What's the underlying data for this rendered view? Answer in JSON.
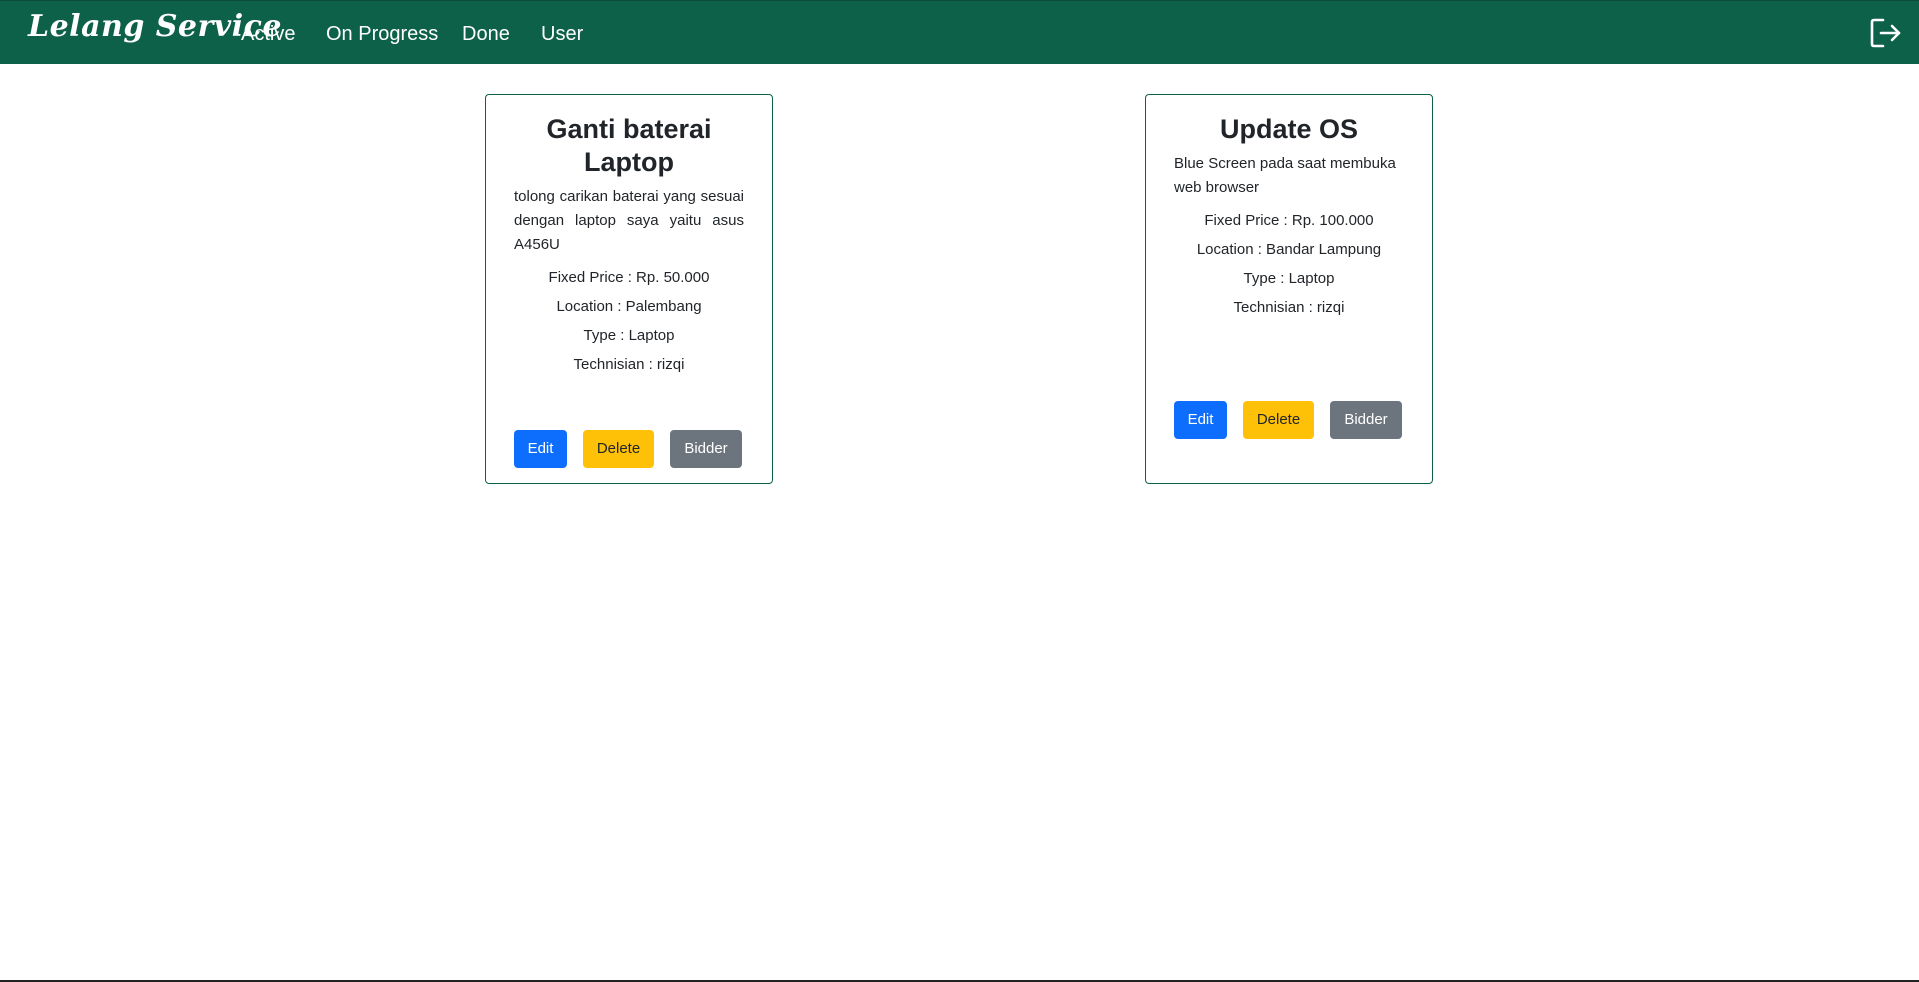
{
  "navbar": {
    "brand": "Lelang Service",
    "items": [
      {
        "label": "Active"
      },
      {
        "label": "On Progress"
      },
      {
        "label": "Done"
      },
      {
        "label": "User"
      }
    ],
    "logout_icon": "logout-icon",
    "background_color": "#0e6149"
  },
  "cards": [
    {
      "title": "Ganti baterai Laptop",
      "description": "tolong carikan baterai yang sesuai dengan laptop saya yaitu asus A456U",
      "price": "Fixed Price : Rp. 50.000",
      "location": "Location : Palembang",
      "type": "Type : Laptop",
      "technician": "Technisian : rizqi",
      "buttons": {
        "edit": "Edit",
        "delete": "Delete",
        "bidder": "Bidder"
      }
    },
    {
      "title": "Update OS",
      "description": "Blue Screen pada saat membuka web browser",
      "price": "Fixed Price : Rp. 100.000",
      "location": "Location : Bandar Lampung",
      "type": "Type : Laptop",
      "technician": "Technisian : rizqi",
      "buttons": {
        "edit": "Edit",
        "delete": "Delete",
        "bidder": "Bidder"
      }
    }
  ],
  "colors": {
    "edit": "#0d6efd",
    "delete": "#ffc107",
    "bidder": "#6c757d"
  }
}
